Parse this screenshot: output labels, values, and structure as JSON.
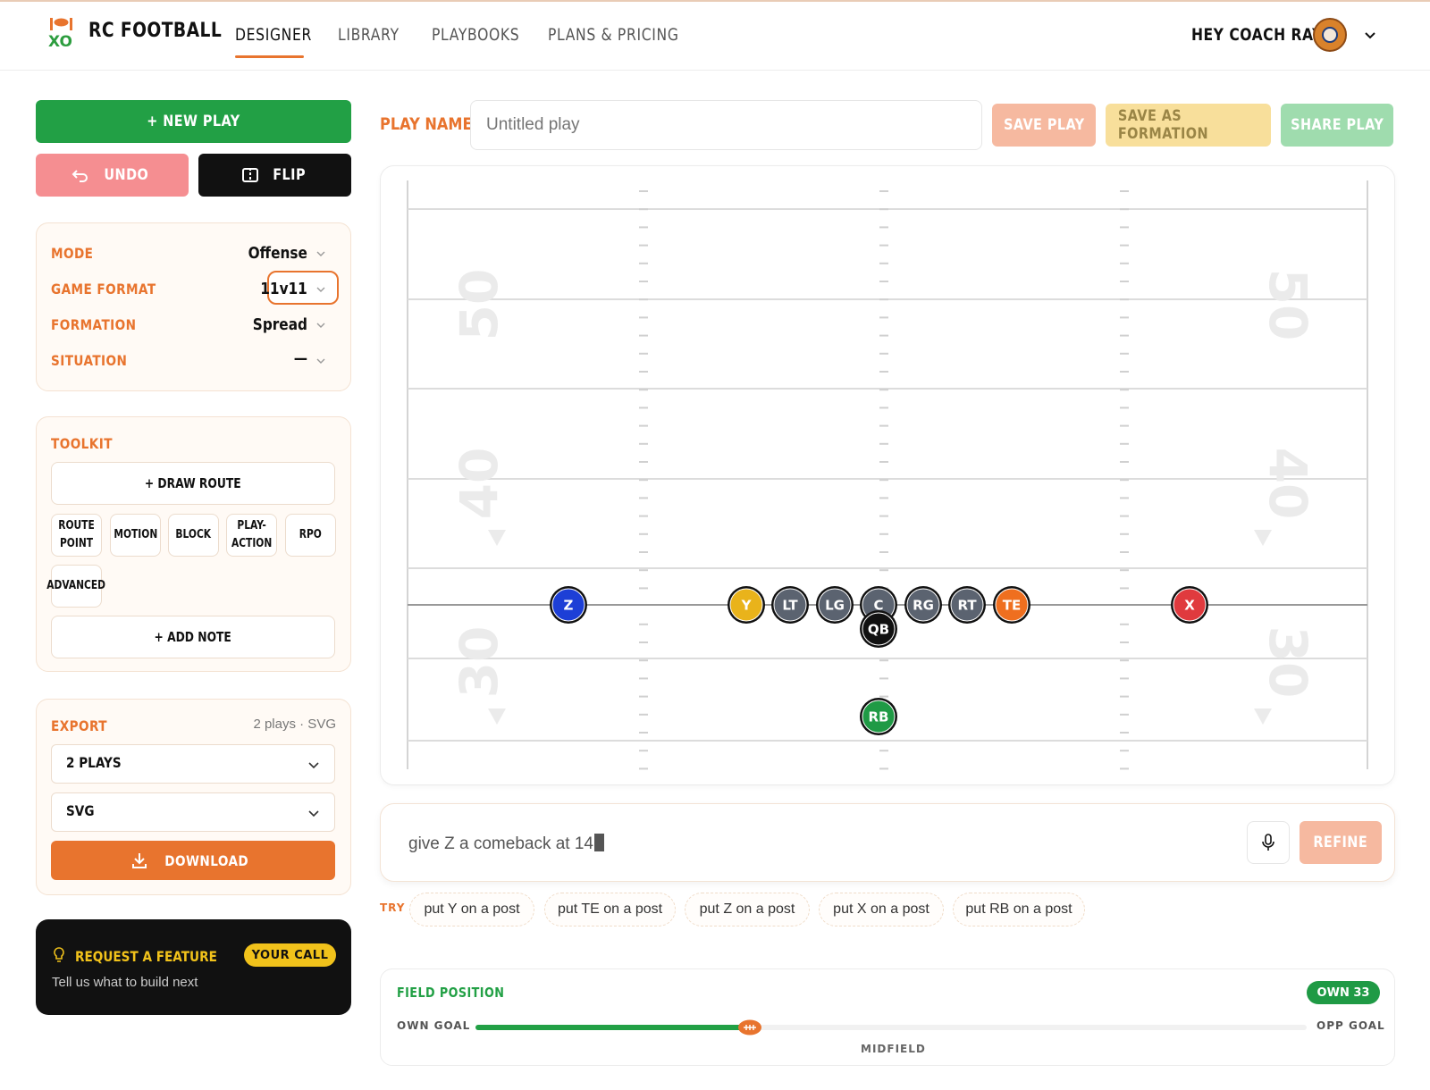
{
  "app": {
    "brand": "RC FOOTBALL"
  },
  "nav": [
    {
      "label": "DESIGNER",
      "active": true
    },
    {
      "label": "LIBRARY",
      "active": false
    },
    {
      "label": "PLAYBOOKS",
      "active": false
    },
    {
      "label": "PLANS & PRICING",
      "active": false
    }
  ],
  "user": {
    "greeting": "HEY COACH RAY"
  },
  "actions": {
    "new_play": "+ NEW PLAY",
    "undo": "UNDO",
    "flip": "FLIP"
  },
  "settings": {
    "mode": {
      "label": "MODE",
      "value": "Offense"
    },
    "game_format": {
      "label": "GAME FORMAT",
      "value": "11v11"
    },
    "formation": {
      "label": "FORMATION",
      "value": "Spread"
    },
    "situation": {
      "label": "SITUATION",
      "value": "—"
    }
  },
  "toolkit": {
    "title": "TOOLKIT",
    "draw_route": "+ DRAW ROUTE",
    "tools": [
      "ROUTE POINT",
      "MOTION",
      "BLOCK",
      "PLAY-ACTION",
      "RPO",
      "ADVANCED"
    ],
    "add_note": "+ ADD NOTE"
  },
  "export": {
    "title": "EXPORT",
    "summary": "2 plays · SVG",
    "plays_select": "2 PLAYS",
    "format_select": "SVG",
    "download": "DOWNLOAD"
  },
  "feature": {
    "title": "REQUEST A FEATURE",
    "badge": "YOUR CALL",
    "subtitle": "Tell us what to build next"
  },
  "play": {
    "name_label": "PLAY NAME",
    "name_placeholder": "Untitled play",
    "save": "SAVE PLAY",
    "save_formation": "SAVE AS FORMATION",
    "share": "SHARE PLAY"
  },
  "field": {
    "yard_numbers": [
      "50",
      "40",
      "30"
    ],
    "players": [
      {
        "id": "Z",
        "color": "#1d3fd6"
      },
      {
        "id": "Y",
        "color": "#e9b31b"
      },
      {
        "id": "LT",
        "color": "#5b6370"
      },
      {
        "id": "LG",
        "color": "#5b6370"
      },
      {
        "id": "C",
        "color": "#5b6370"
      },
      {
        "id": "RG",
        "color": "#5b6370"
      },
      {
        "id": "RT",
        "color": "#5b6370"
      },
      {
        "id": "TE",
        "color": "#ef6f1f"
      },
      {
        "id": "X",
        "color": "#e03a3e"
      },
      {
        "id": "QB",
        "color": "#111111"
      },
      {
        "id": "RB",
        "color": "#1f9a45"
      }
    ]
  },
  "prompt": {
    "text": "give Z a comeback at 14",
    "refine": "REFINE"
  },
  "suggestions": {
    "label": "TRY",
    "items": [
      "put Y on a post",
      "put TE on a post",
      "put Z on a post",
      "put X on a post",
      "put RB on a post"
    ]
  },
  "field_position": {
    "title": "FIELD POSITION",
    "badge": "OWN 33",
    "own_goal": "OWN GOAL",
    "opp_goal": "OPP GOAL",
    "midfield": "MIDFIELD",
    "progress": 0.33
  }
}
